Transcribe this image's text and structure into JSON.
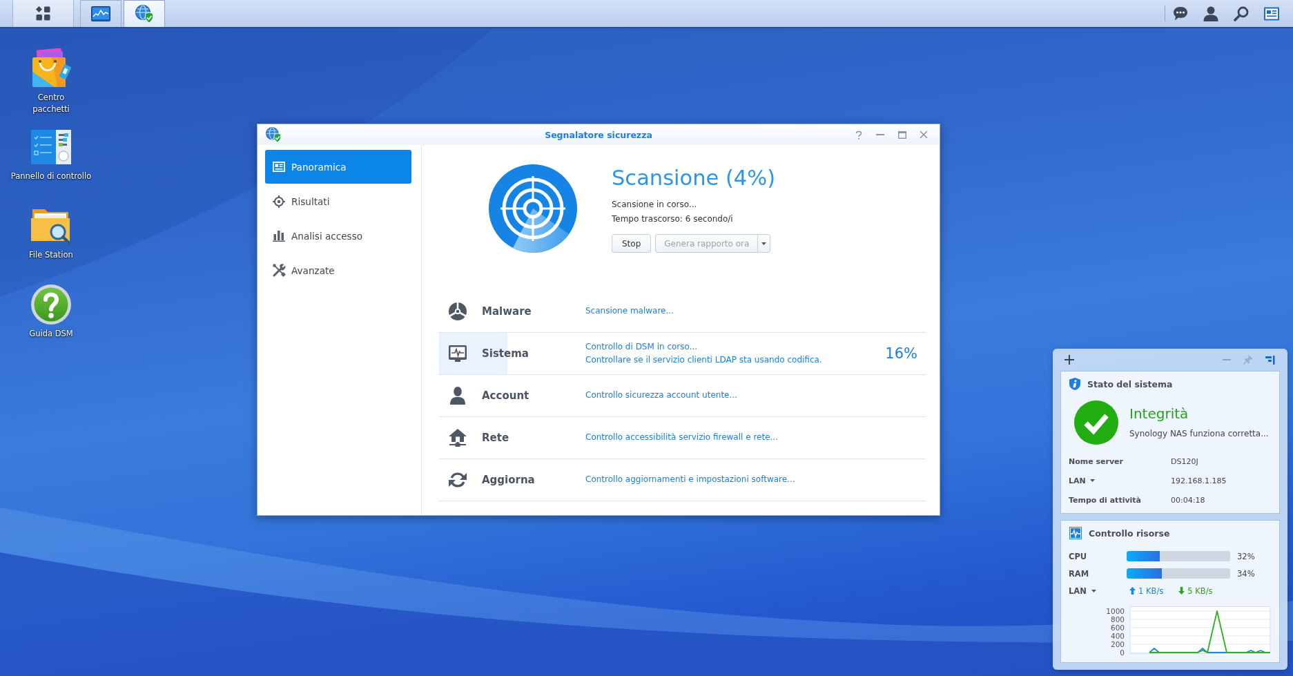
{
  "taskbar": {
    "apps": [
      {
        "kind": "resource_monitor",
        "selected": false
      },
      {
        "kind": "security_advisor",
        "selected": true
      }
    ]
  },
  "desktop_icons": [
    {
      "kind": "package_center",
      "label": "Centro\npacchetti"
    },
    {
      "kind": "control_panel",
      "label": "Pannello di controllo"
    },
    {
      "kind": "file_station",
      "label": "File Station"
    },
    {
      "kind": "help",
      "label": "Guida DSM"
    }
  ],
  "window": {
    "title": "Segnalatore sicurezza",
    "sidebar": {
      "items": [
        {
          "kind": "overview",
          "label": "Panoramica",
          "selected": true
        },
        {
          "kind": "results",
          "label": "Risultati",
          "selected": false
        },
        {
          "kind": "logins",
          "label": "Analisi accesso",
          "selected": false
        },
        {
          "kind": "advanced",
          "label": "Avanzate",
          "selected": false
        }
      ]
    },
    "scan": {
      "title": "Scansione (4%)",
      "status": "Scansione in corso...",
      "elapsed": "Tempo trascorso: 6 secondo/i",
      "buttons": [
        {
          "kind": "plain",
          "label": "Stop",
          "disabled": false
        },
        {
          "kind": "split",
          "label": "Genera rapporto ora",
          "disabled": true
        }
      ]
    },
    "categories": [
      {
        "kind": "malware",
        "name": "Malware",
        "details": [
          "Scansione malware..."
        ]
      },
      {
        "kind": "system",
        "name": "Sistema",
        "details": [
          "Controllo di DSM in corso...",
          "Controllare se il servizio clienti LDAP sta usando codifica."
        ],
        "level": 0.14,
        "reading": "16%"
      },
      {
        "kind": "account",
        "name": "Account",
        "details": [
          "Controllo sicurezza account utente..."
        ]
      },
      {
        "kind": "network",
        "name": "Rete",
        "details": [
          "Controllo accessibilità servizio firewall e rete..."
        ]
      },
      {
        "kind": "update",
        "name": "Aggiorna",
        "details": [
          "Controllo aggiornamenti e impostazioni software..."
        ]
      }
    ]
  },
  "widgets": {
    "status": {
      "title": "Stato del sistema",
      "health": "Integrità",
      "message": "Synology NAS funziona corretta...",
      "rows": [
        {
          "label": "Nome server",
          "value": "DS120J",
          "dropdown": false
        },
        {
          "label": "LAN",
          "value": "192.168.1.185",
          "dropdown": true
        },
        {
          "label": "Tempo di attività",
          "value": "00:04:18",
          "dropdown": false
        }
      ]
    },
    "resources": {
      "title": "Controllo risorse",
      "meters": [
        {
          "name": "CPU",
          "level": 0.32,
          "reading": "32%"
        },
        {
          "name": "RAM",
          "level": 0.34,
          "reading": "34%"
        }
      ],
      "network": {
        "label": "LAN",
        "dropdown": true,
        "upload": "1 KB/s",
        "download": "5 KB/s",
        "chart_data": {
          "type": "line",
          "grid": true,
          "ylim": [
            0,
            1000
          ],
          "yticks": [
            0,
            200,
            400,
            600,
            800,
            1000
          ],
          "series": [
            {
              "color": "#1a86e3",
              "values": [
                null,
                null,
                null,
                null,
                0,
                100,
                0,
                0,
                0,
                0,
                0,
                0,
                0,
                0,
                0,
                100,
                0,
                0,
                0,
                0,
                0,
                0,
                0,
                0,
                0,
                50,
                0,
                50,
                0,
                0
              ]
            },
            {
              "color": "#2ab01c",
              "values": [
                null,
                null,
                null,
                null,
                0,
                0,
                0,
                0,
                0,
                0,
                0,
                0,
                0,
                0,
                0,
                50,
                0,
                500,
                1000,
                500,
                0,
                0,
                0,
                0,
                0,
                0,
                0,
                0,
                0,
                0
              ]
            }
          ]
        }
      }
    }
  }
}
